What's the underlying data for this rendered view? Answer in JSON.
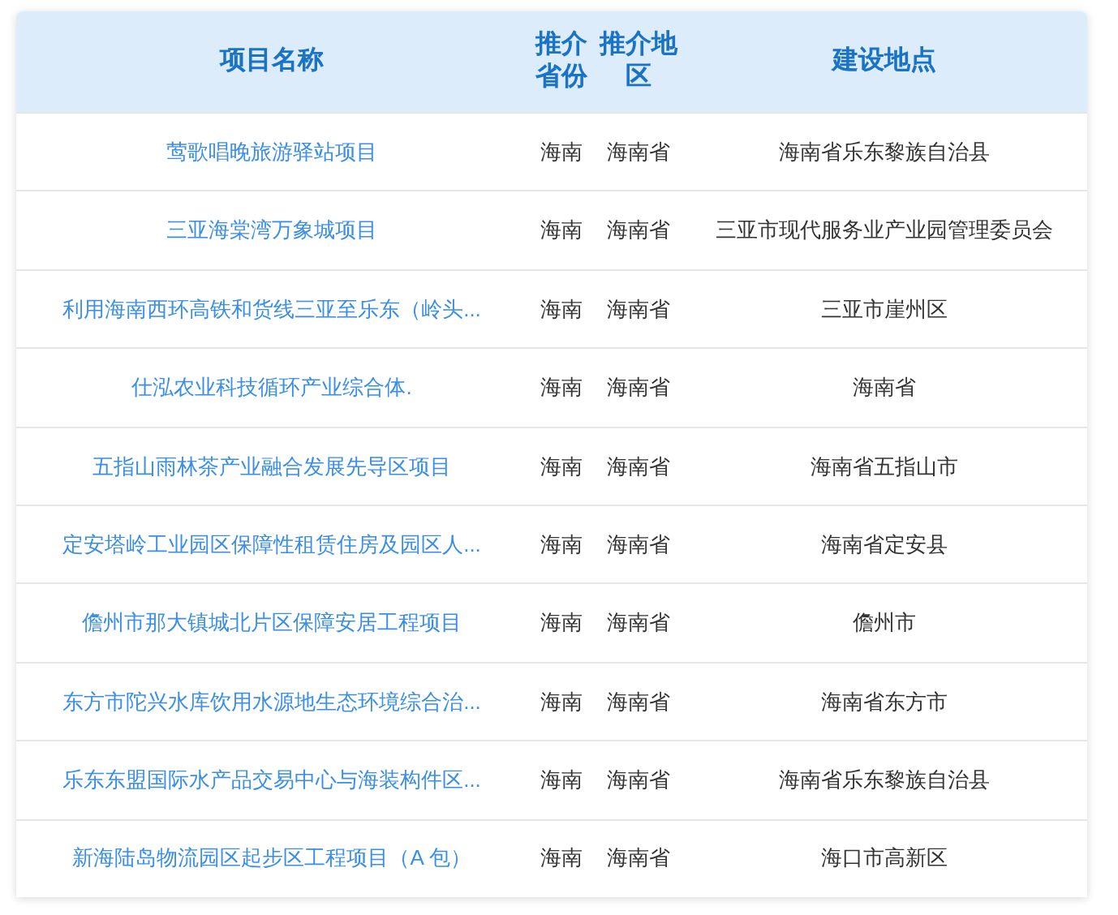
{
  "table": {
    "columns": [
      "项目名称",
      "推介省份",
      "推介地区",
      "建设地点"
    ],
    "rows": [
      {
        "name": "莺歌唱晚旅游驿站项目",
        "province": "海南",
        "region": "海南省",
        "location": "海南省乐东黎族自治县"
      },
      {
        "name": "三亚海棠湾万象城项目",
        "province": "海南",
        "region": "海南省",
        "location": "三亚市现代服务业产业园管理委员会"
      },
      {
        "name": "利用海南西环高铁和货线三亚至乐东（岭头...",
        "province": "海南",
        "region": "海南省",
        "location": "三亚市崖州区"
      },
      {
        "name": "仕泓农业科技循环产业综合体.",
        "province": "海南",
        "region": "海南省",
        "location": "海南省"
      },
      {
        "name": "五指山雨林茶产业融合发展先导区项目",
        "province": "海南",
        "region": "海南省",
        "location": "海南省五指山市"
      },
      {
        "name": "定安塔岭工业园区保障性租赁住房及园区人...",
        "province": "海南",
        "region": "海南省",
        "location": "海南省定安县"
      },
      {
        "name": "儋州市那大镇城北片区保障安居工程项目",
        "province": "海南",
        "region": "海南省",
        "location": "儋州市"
      },
      {
        "name": "东方市陀兴水库饮用水源地生态环境综合治...",
        "province": "海南",
        "region": "海南省",
        "location": "海南省东方市"
      },
      {
        "name": "乐东东盟国际水产品交易中心与海装构件区...",
        "province": "海南",
        "region": "海南省",
        "location": "海南省乐东黎族自治县"
      },
      {
        "name": "新海陆岛物流园区起步区工程项目（A 包）",
        "province": "海南",
        "region": "海南省",
        "location": "海口市高新区"
      }
    ]
  }
}
